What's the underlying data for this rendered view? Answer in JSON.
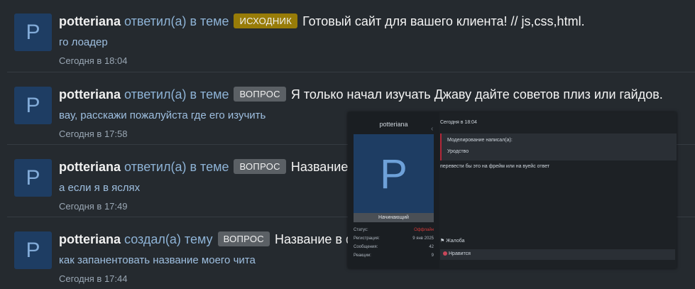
{
  "feed": [
    {
      "avatar_letter": "P",
      "user": "potteriana",
      "action": "ответил(а) в теме",
      "badge": "ИСХОДНИК",
      "badge_color": "#987c08",
      "title": "Готовый сайт для вашего клиента! // js,css,html.",
      "snippet": "го лоадер",
      "time": "Сегодня в 18:04"
    },
    {
      "avatar_letter": "P",
      "user": "potteriana",
      "action": "ответил(а) в теме",
      "badge": "ВОПРОС",
      "badge_color": "#5b6065",
      "title": "Я только начал изучать Джаву дайте советов плиз или гайдов.",
      "snippet": "вау, расскажи пожалуйста где его изучить",
      "time": "Сегодня в 17:58"
    },
    {
      "avatar_letter": "P",
      "user": "potteriana",
      "action": "ответил(а) в теме",
      "badge": "ВОПРОС",
      "badge_color": "#5b6065",
      "title": "Название.",
      "snippet": "а если я в яслях",
      "time": "Сегодня в 17:49"
    },
    {
      "avatar_letter": "P",
      "user": "potteriana",
      "action": "создал(а) тему",
      "badge": "ВОПРОС",
      "badge_color": "#5b6065",
      "title": "Название в ф",
      "snippet": "как запанентовать название моего чита",
      "time": "Сегодня в 17:44"
    }
  ],
  "popup": {
    "username": "potteriana",
    "avatar_letter": "P",
    "rank": "Начинающий",
    "date": "Сегодня в 18:04",
    "stats": [
      {
        "label": "Статус:",
        "value": "Оффлайн",
        "color": "#d63a3a"
      },
      {
        "label": "Регистрация:",
        "value": "9 янв 2025",
        "color": ""
      },
      {
        "label": "Сообщения:",
        "value": "42",
        "color": ""
      },
      {
        "label": "Реакции:",
        "value": "9",
        "color": ""
      }
    ],
    "quote_header": "Моделирование написал(а):",
    "quote_body": "Уродство",
    "post_text": "перевести бы это на фрейм или на вуейс ответ",
    "complaint": "Жалоба",
    "reaction": "Нравится"
  },
  "colors": {
    "background": "#252a2f",
    "avatar_bg": "#1e3d63",
    "action_text": "#8eb3d6",
    "snippet_text": "#9ebfe0"
  }
}
